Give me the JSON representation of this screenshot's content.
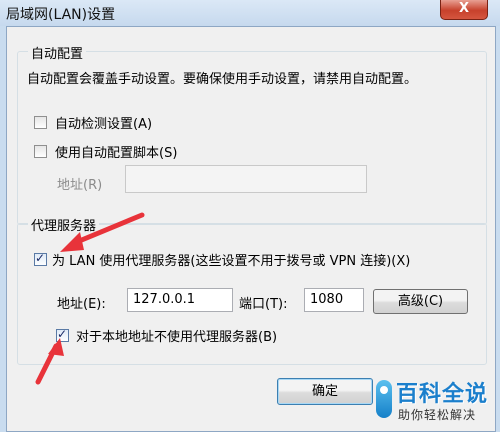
{
  "window": {
    "title": "局域网(LAN)设置",
    "close_glyph": "X"
  },
  "auto_config": {
    "group_label": "自动配置",
    "description": "自动配置会覆盖手动设置。要确保使用手动设置，请禁用自动配置。",
    "auto_detect": {
      "label": "自动检测设置(A)",
      "checked": false
    },
    "use_script": {
      "label": "使用自动配置脚本(S)",
      "checked": false
    },
    "address_label": "地址(R)",
    "address_value": ""
  },
  "proxy": {
    "group_label": "代理服务器",
    "use_proxy": {
      "label": "为 LAN 使用代理服务器(这些设置不用于拨号或 VPN 连接)(X)",
      "checked": true
    },
    "address_label": "地址(E):",
    "address_value": "127.0.0.1",
    "port_label": "端口(T):",
    "port_value": "1080",
    "advanced_button": "高级(C)",
    "bypass_local": {
      "label": "对于本地地址不使用代理服务器(B)",
      "checked": true
    }
  },
  "buttons": {
    "ok": "确定"
  },
  "watermark": {
    "main": "百科全说",
    "sub": "助你轻松解决"
  },
  "colors": {
    "annotation_arrow": "#e8333a",
    "watermark_blue": "#1b7fcc"
  }
}
